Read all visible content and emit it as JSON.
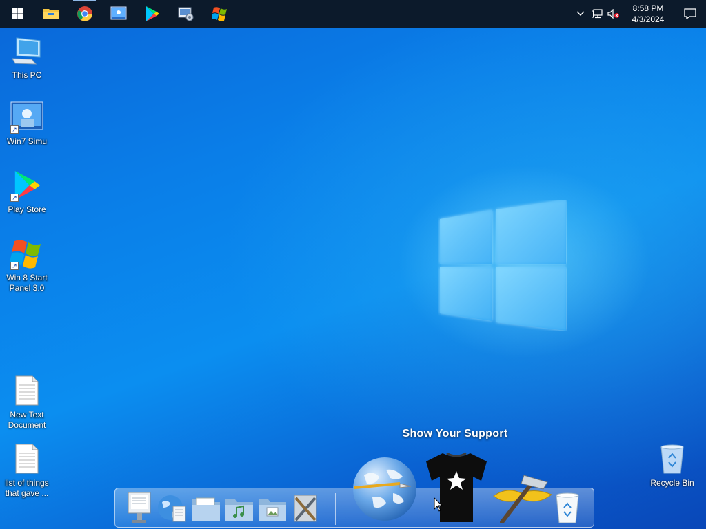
{
  "taskbar": {
    "apps": [
      {
        "name": "start-icon"
      },
      {
        "name": "file-explorer-icon"
      },
      {
        "name": "chrome-icon"
      },
      {
        "name": "win7-simu-icon"
      },
      {
        "name": "play-store-icon"
      },
      {
        "name": "settings-media-icon"
      },
      {
        "name": "win8-start-panel-icon"
      }
    ],
    "tray": {
      "time": "8:58 PM",
      "date": "4/3/2024"
    }
  },
  "desktop": {
    "icons": [
      {
        "label": "This PC",
        "icon": "computer-icon"
      },
      {
        "label": "Win7 Simu",
        "icon": "win7-simu-icon"
      },
      {
        "label": "Play Store",
        "icon": "play-store-icon"
      },
      {
        "label": "Win 8 Start Panel 3.0",
        "icon": "windows-flag-icon"
      },
      {
        "label": "New Text Document",
        "icon": "text-document-icon"
      },
      {
        "label": "list of things that gave ...",
        "icon": "text-document-icon"
      },
      {
        "label": "Recycle Bin",
        "icon": "recycle-bin-icon"
      }
    ]
  },
  "dock": {
    "caption": "Show Your Support",
    "items": [
      "finder-monitor-icon",
      "web-globe-icon",
      "documents-folder-icon",
      "music-folder-icon",
      "pictures-folder-icon",
      "system-tools-icon",
      "network-globe-icon",
      "tshirt-icon",
      "hammer-icon",
      "trash-icon"
    ]
  },
  "colors": {
    "taskbar": "#0c1a2b",
    "desktop_accent": "#0a7ee8"
  }
}
